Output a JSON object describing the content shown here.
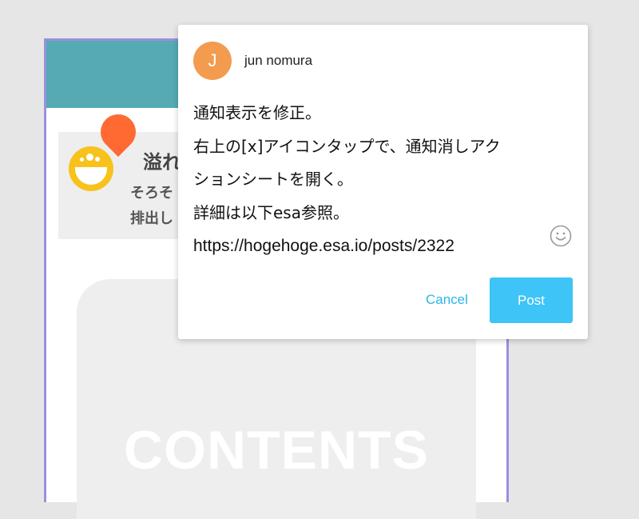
{
  "background": {
    "notification": {
      "title_fragment": "溢れそ",
      "line1_fragment": "そろそ",
      "line2_fragment": "排出し"
    },
    "content_label": "CONTENTS"
  },
  "comment_popup": {
    "avatar_initial": "J",
    "user_name": "jun nomura",
    "lines": [
      "通知表示を修正。",
      "右上の[x]アイコンタップで、通知消しアク",
      "ションシートを開く。",
      "詳細は以下esa参照。",
      "https://hogehoge.esa.io/posts/2322"
    ],
    "emoji_icon": "smiley-face-icon",
    "cancel_label": "Cancel",
    "post_label": "Post"
  },
  "colors": {
    "header_teal": "#55aab4",
    "phone_border": "#9b8fe0",
    "avatar_orange": "#f39b4f",
    "marker_orange": "#ff6a33",
    "logo_yellow": "#f7c21b",
    "accent_blue": "#3ec4f6",
    "cancel_blue": "#2ab6e8"
  }
}
